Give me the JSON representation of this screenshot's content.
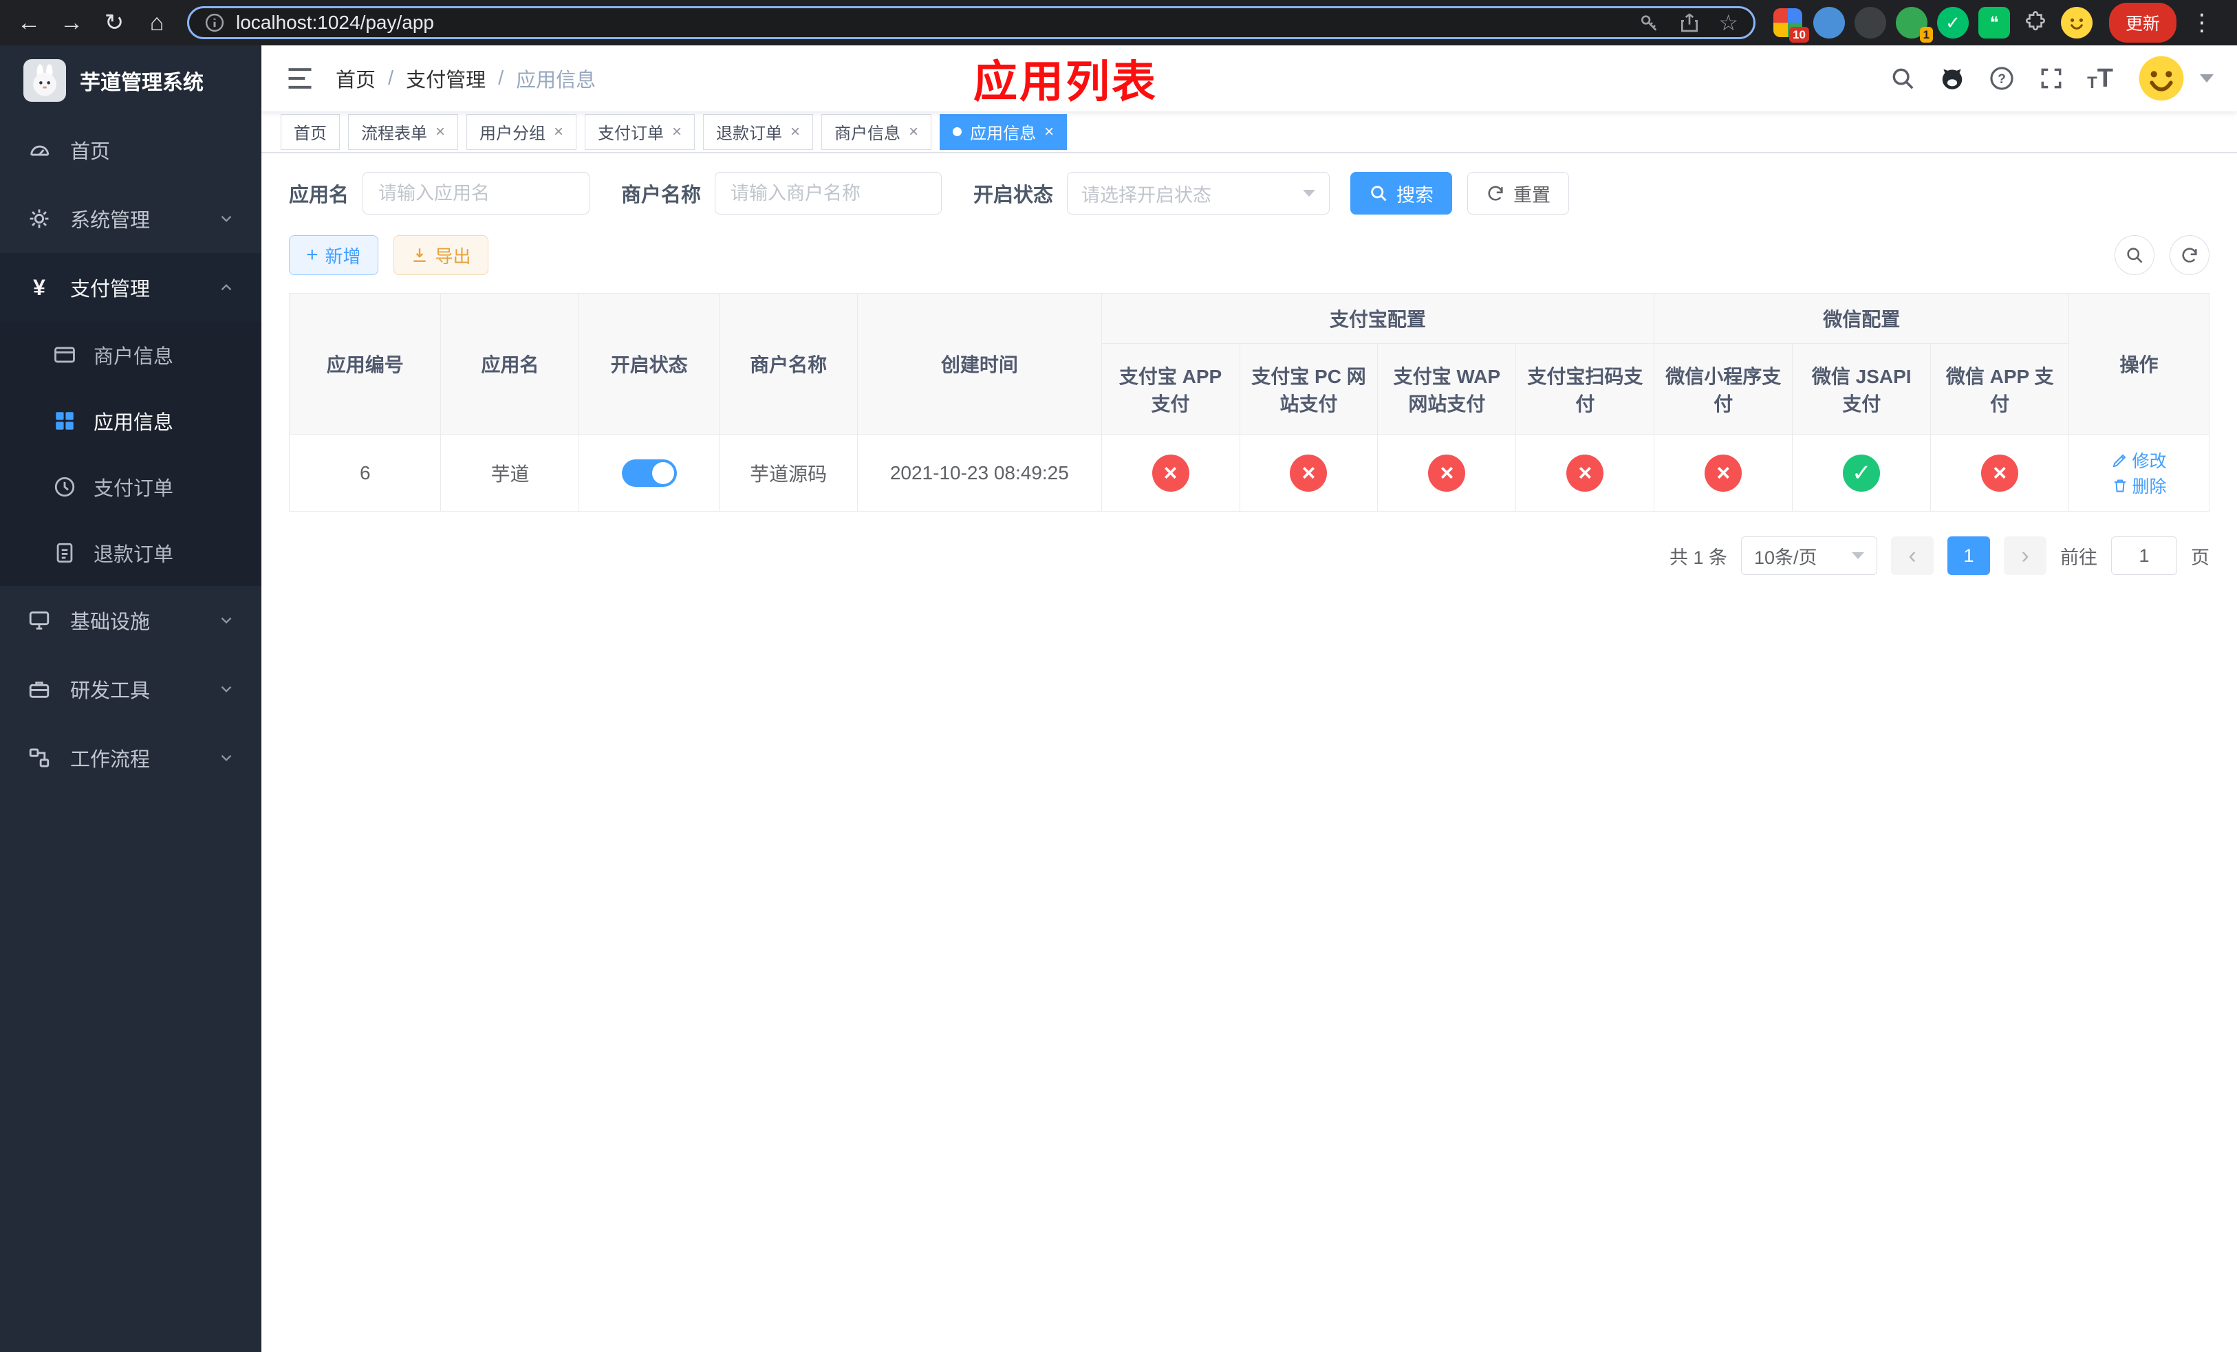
{
  "browser": {
    "url": "localhost:1024/pay/app",
    "update_label": "更新",
    "ext_badge_grid": "10",
    "ext_badge_avatar": "1"
  },
  "sidebar": {
    "title": "芋道管理系统",
    "items": [
      {
        "label": "首页"
      },
      {
        "label": "系统管理"
      },
      {
        "label": "支付管理",
        "children": [
          {
            "label": "商户信息"
          },
          {
            "label": "应用信息"
          },
          {
            "label": "支付订单"
          },
          {
            "label": "退款订单"
          }
        ]
      },
      {
        "label": "基础设施"
      },
      {
        "label": "研发工具"
      },
      {
        "label": "工作流程"
      }
    ]
  },
  "header": {
    "breadcrumb": [
      "首页",
      "支付管理",
      "应用信息"
    ],
    "annotation": "应用列表"
  },
  "tabs": [
    {
      "label": "首页"
    },
    {
      "label": "流程表单"
    },
    {
      "label": "用户分组"
    },
    {
      "label": "支付订单"
    },
    {
      "label": "退款订单"
    },
    {
      "label": "商户信息"
    },
    {
      "label": "应用信息"
    }
  ],
  "filters": {
    "app_name_label": "应用名",
    "app_name_placeholder": "请输入应用名",
    "merchant_label": "商户名称",
    "merchant_placeholder": "请输入商户名称",
    "status_label": "开启状态",
    "status_placeholder": "请选择开启状态",
    "search_label": "搜索",
    "reset_label": "重置"
  },
  "toolbar": {
    "add_label": "新增",
    "export_label": "导出"
  },
  "table": {
    "headers": {
      "app_id": "应用编号",
      "app_name": "应用名",
      "status": "开启状态",
      "merchant": "商户名称",
      "created": "创建时间",
      "alipay_group": "支付宝配置",
      "wechat_group": "微信配置",
      "ops": "操作",
      "channels": [
        "支付宝 APP 支付",
        "支付宝 PC 网站支付",
        "支付宝 WAP 网站支付",
        "支付宝扫码支付",
        "微信小程序支付",
        "微信 JSAPI 支付",
        "微信 APP 支付"
      ]
    },
    "row": {
      "id": "6",
      "name": "芋道",
      "status_on": true,
      "merchant": "芋道源码",
      "created": "2021-10-23 08:49:25",
      "channels": [
        "cross",
        "cross",
        "cross",
        "cross",
        "cross",
        "check",
        "cross"
      ],
      "edit_label": "修改",
      "delete_label": "删除"
    }
  },
  "pagination": {
    "total": "共 1 条",
    "page_size": "10条/页",
    "page": "1",
    "goto_label": "前往",
    "goto_value": "1",
    "goto_suffix": "页"
  },
  "colors": {
    "accent": "#409eff",
    "success": "#1dc779",
    "danger": "#f65252",
    "warning": "#e6a23c"
  }
}
